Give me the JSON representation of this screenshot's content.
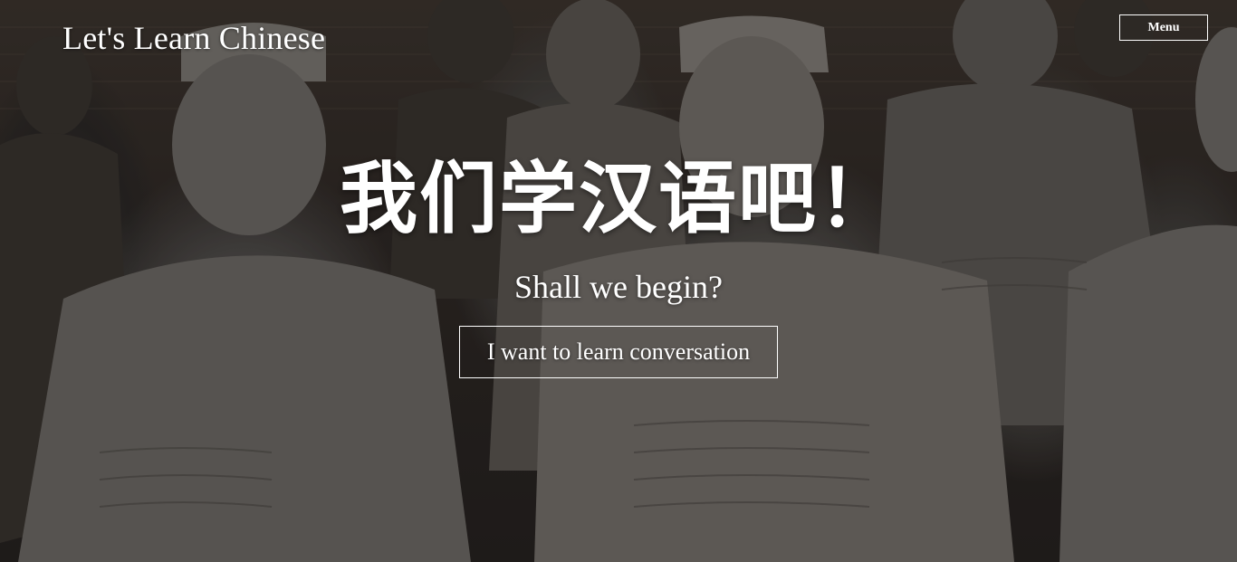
{
  "header": {
    "site_title": "Let's Learn Chinese",
    "menu_label": "Menu"
  },
  "hero": {
    "background_image": "terracotta-warriors-photo",
    "headline": "我们学汉语吧！",
    "subtitle": "Shall we begin?",
    "cta_label": "I want to learn conversation"
  },
  "colors": {
    "text": "#ffffff",
    "button_border": "#ffffff"
  }
}
